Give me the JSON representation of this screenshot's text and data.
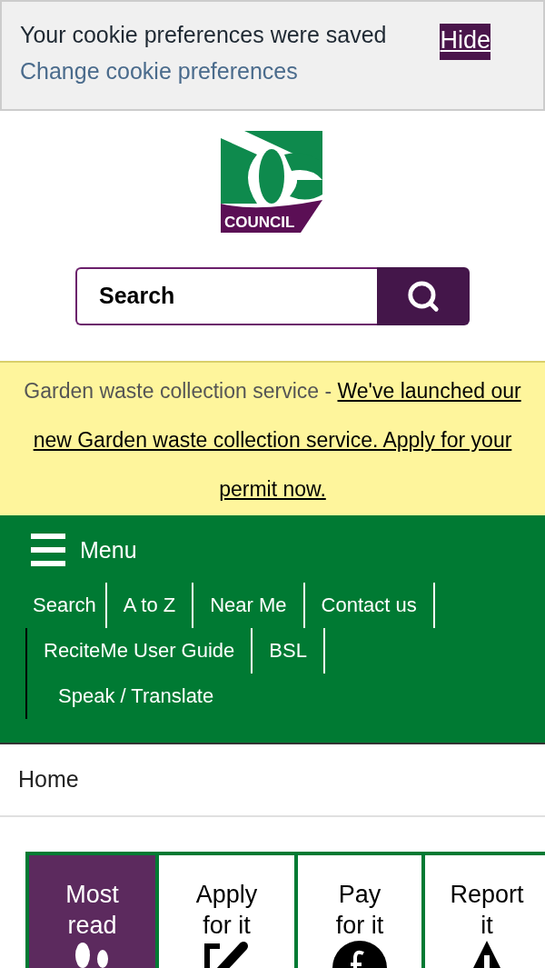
{
  "cookie_banner": {
    "message": "Your cookie preferences were saved",
    "link": "Change cookie preferences",
    "hide_button": "Hide"
  },
  "logo": {
    "text": "COUNCIL"
  },
  "search": {
    "placeholder": "Search"
  },
  "alert": {
    "label": "Garden waste collection service - ",
    "link": "We've launched our new Garden waste collection service. Apply for your permit now."
  },
  "menu": {
    "label": "Menu",
    "links": [
      {
        "label": "Search"
      },
      {
        "label": "A to Z"
      },
      {
        "label": "Near Me"
      },
      {
        "label": "Contact us"
      },
      {
        "label": "ReciteMe User Guide"
      },
      {
        "label": "BSL"
      },
      {
        "label": "Speak / Translate"
      }
    ]
  },
  "breadcrumb": [
    "Home"
  ],
  "tabs": [
    {
      "label": "Most read",
      "selected": true
    },
    {
      "label": "Apply for it",
      "selected": false
    },
    {
      "label": "Pay for it",
      "selected": false
    },
    {
      "label": "Report it",
      "selected": false
    }
  ]
}
